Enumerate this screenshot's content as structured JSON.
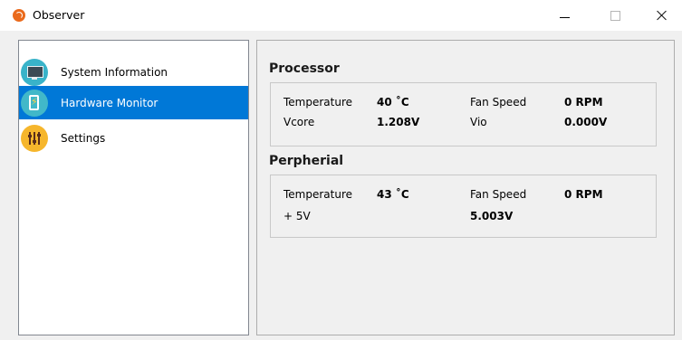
{
  "window": {
    "title": "Observer"
  },
  "nav": {
    "items": [
      {
        "label": "System Information",
        "icon": "monitor-icon",
        "selected": false
      },
      {
        "label": "Hardware Monitor",
        "icon": "battery-icon",
        "selected": true
      },
      {
        "label": "Settings",
        "icon": "sliders-icon",
        "selected": false
      }
    ]
  },
  "processor": {
    "title": "Processor",
    "temperature_label": "Temperature",
    "temperature_value": "40 ˚C",
    "fan_label": "Fan Speed",
    "fan_value": "0 RPM",
    "vcore_label": "Vcore",
    "vcore_value": "1.208V",
    "vio_label": "Vio",
    "vio_value": "0.000V"
  },
  "peripheral": {
    "title": "Perpherial",
    "temperature_label": "Temperature",
    "temperature_value": "43 ˚C",
    "fan_label": "Fan Speed",
    "fan_value": "0 RPM",
    "v5_label": "+ 5V",
    "v5_value": "5.003V"
  },
  "colors": {
    "selection": "#0078d7",
    "window_bg": "#f0f0f0",
    "app_icon": "#ea6a1c"
  }
}
